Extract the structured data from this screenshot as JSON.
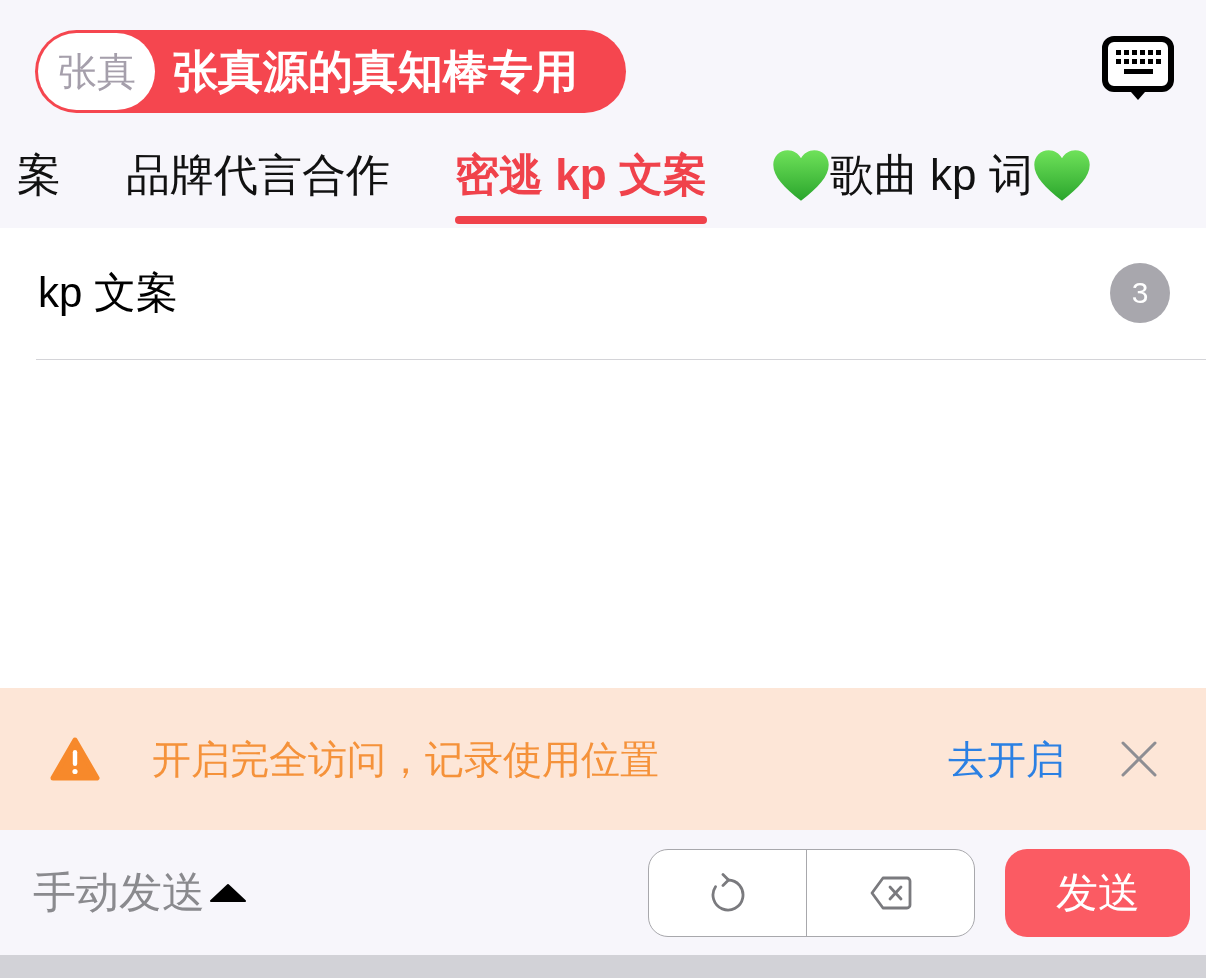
{
  "header": {
    "pack_avatar": "张真",
    "pack_title": "张真源的真知棒专用"
  },
  "tabs": [
    {
      "label": "案",
      "kind": "plain",
      "selected": false
    },
    {
      "label": "品牌代言合作",
      "kind": "plain",
      "selected": false
    },
    {
      "label": "密逃 kp 文案",
      "kind": "plain",
      "selected": true
    },
    {
      "label": "歌曲 kp 词",
      "kind": "hearts",
      "selected": false
    }
  ],
  "list": [
    {
      "title": "kp 文案",
      "count": "3"
    }
  ],
  "notice": {
    "message": "开启完全访问，记录使用位置",
    "action": "去开启"
  },
  "toolbar": {
    "mode": "手动发送",
    "send": "发送"
  }
}
